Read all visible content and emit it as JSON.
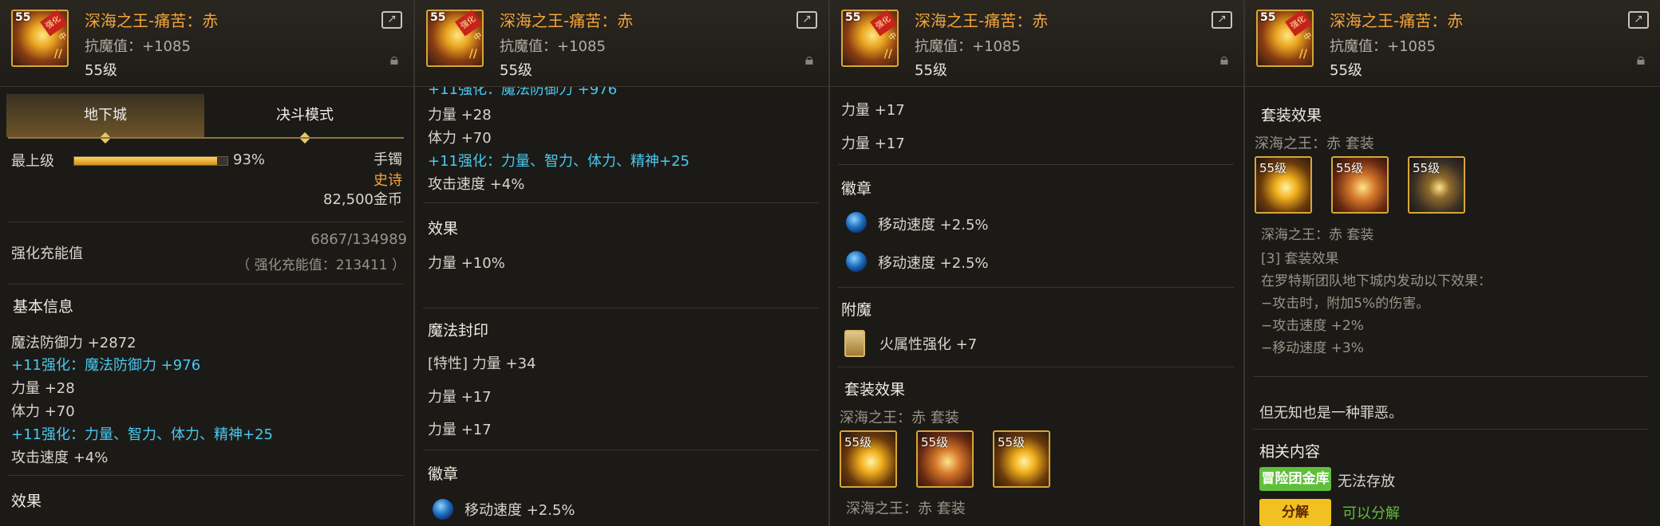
{
  "item": {
    "name": "深海之王-痛苦：赤",
    "magic_resist": "抗魔值：+1085",
    "level": "55级",
    "icon_level": "55",
    "badge": "强化中",
    "icon_suffix": "//"
  },
  "icons": {
    "share": "share-icon",
    "lock": "lock-icon"
  },
  "panel1": {
    "tabs": [
      "地下城",
      "决斗模式"
    ],
    "grade_label": "最上级",
    "grade_percent": "93%",
    "grade_value": 0.93,
    "slot": "手镯",
    "rarity": "史诗",
    "price": "82,500金币",
    "charge_label": "强化充能值",
    "charge_value": "6867/134989",
    "charge_total": "（ 强化充能值：213411 ）",
    "basic_title": "基本信息",
    "stats": [
      "魔法防御力 +2872",
      "+11强化：魔法防御力 +976",
      "力量 +28",
      "体力 +70",
      "+11强化：力量、智力、体力、精神+25",
      "攻击速度 +4%"
    ],
    "effect_title": "效果"
  },
  "panel2": {
    "top_cut": "+11强化：魔法防御力 +976",
    "stats": [
      "力量 +28",
      "体力 +70",
      "+11强化：力量、智力、体力、精神+25",
      "攻击速度 +4%"
    ],
    "effect_title": "效果",
    "effect": "力量 +10%",
    "seal_title": "魔法封印",
    "seal_trait": "[特性] 力量 +34",
    "seal_lines": [
      "力量 +17",
      "力量 +17"
    ],
    "emblem_title": "徽章",
    "emblem": "移动速度 +2.5%"
  },
  "panel3": {
    "lines": [
      "力量 +17",
      "力量 +17"
    ],
    "emblem_title": "徽章",
    "emblems": [
      "移动速度 +2.5%",
      "移动速度 +2.5%"
    ],
    "enchant_title": "附魔",
    "enchant": "火属性强化 +7",
    "set_title": "套装效果",
    "set_name": "深海之王：赤 套装",
    "set_levels": [
      "55级",
      "55级",
      "55级"
    ],
    "set_footer": "深海之王：赤 套装"
  },
  "panel4": {
    "set_title": "套装效果",
    "set_name": "深海之王：赤 套装",
    "set_levels": [
      "55级",
      "55级",
      "55级"
    ],
    "set_sub": "深海之王：赤 套装",
    "set_bonus": "[3] 套装效果",
    "set_desc": [
      "在罗特斯团队地下城内发动以下效果：",
      "−攻击时，附加5%的伤害。",
      "−攻击速度 +2%",
      "−移动速度 +3%"
    ],
    "flavor": "但无知也是一种罪恶。",
    "related_title": "相关内容",
    "vault_label": "冒险团金库",
    "vault_status": "无法存放",
    "decompose_label": "分解",
    "decompose_status": "可以分解"
  }
}
